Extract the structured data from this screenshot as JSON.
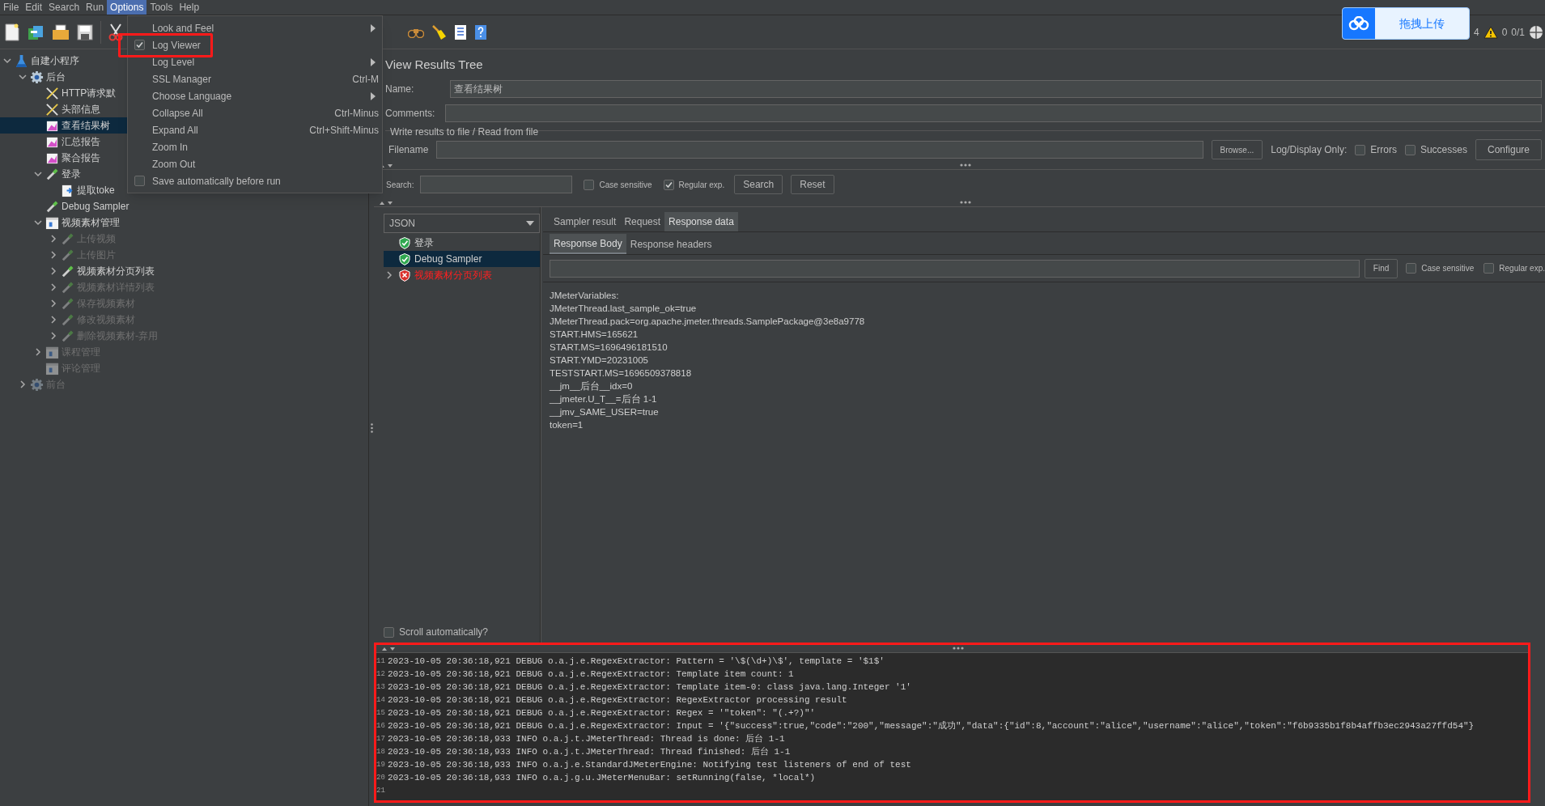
{
  "menu_bar": [
    {
      "label": "File",
      "selected": false
    },
    {
      "label": "Edit",
      "selected": false
    },
    {
      "label": "Search",
      "selected": false
    },
    {
      "label": "Run",
      "selected": false
    },
    {
      "label": "Options",
      "selected": true
    },
    {
      "label": "Tools",
      "selected": false
    },
    {
      "label": "Help",
      "selected": false
    }
  ],
  "options_menu": [
    {
      "kind": "submenu",
      "label": "Look and Feel",
      "highlighted": false
    },
    {
      "kind": "check",
      "label": "Log Viewer",
      "checked": true,
      "highlighted": true
    },
    {
      "kind": "submenu",
      "label": "Log Level",
      "highlighted": false
    },
    {
      "kind": "command",
      "label": "SSL Manager",
      "shortcut": "Ctrl-M",
      "highlighted": false
    },
    {
      "kind": "submenu",
      "label": "Choose Language",
      "highlighted": false
    },
    {
      "kind": "command",
      "label": "Collapse All",
      "shortcut": "Ctrl-Minus",
      "highlighted": false
    },
    {
      "kind": "command",
      "label": "Expand All",
      "shortcut": "Ctrl+Shift-Minus",
      "highlighted": false
    },
    {
      "kind": "command",
      "label": "Zoom In",
      "highlighted": false
    },
    {
      "kind": "command",
      "label": "Zoom Out",
      "highlighted": false
    },
    {
      "kind": "check",
      "label": "Save automatically before run",
      "checked": false,
      "highlighted": false
    }
  ],
  "upload_button": "拖拽上传",
  "status": {
    "errors_count": "4",
    "warnings_count": "0",
    "threads": "0/1"
  },
  "tree": [
    {
      "label": "自建小程序",
      "kind": "flask",
      "expanded": true,
      "selected": false,
      "disabled": false,
      "children": [
        {
          "label": "后台",
          "kind": "gear",
          "expanded": true,
          "selected": false,
          "disabled": false,
          "children": [
            {
              "label": "HTTP请求默",
              "kind": "tools",
              "selected": false,
              "disabled": false
            },
            {
              "label": "头部信息",
              "kind": "tools",
              "selected": false,
              "disabled": false
            },
            {
              "label": "查看结果树",
              "kind": "chart",
              "selected": true,
              "disabled": false
            },
            {
              "label": "汇总报告",
              "kind": "chart",
              "selected": false,
              "disabled": false
            },
            {
              "label": "聚合报告",
              "kind": "chart",
              "selected": false,
              "disabled": false
            },
            {
              "label": "登录",
              "kind": "pipette",
              "expanded": true,
              "selected": false,
              "disabled": false,
              "children": [
                {
                  "label": "提取toke",
                  "kind": "script",
                  "selected": false,
                  "disabled": false
                }
              ]
            },
            {
              "label": "Debug Sampler",
              "kind": "pipette",
              "selected": false,
              "disabled": false
            },
            {
              "label": "视频素材管理",
              "kind": "controller",
              "expanded": true,
              "selected": false,
              "disabled": false,
              "children": [
                {
                  "label": "上传视频",
                  "kind": "pipette",
                  "expanded": false,
                  "selected": false,
                  "disabled": true
                },
                {
                  "label": "上传图片",
                  "kind": "pipette",
                  "expanded": false,
                  "selected": false,
                  "disabled": true
                },
                {
                  "label": "视频素材分页列表",
                  "kind": "pipette",
                  "expanded": false,
                  "selected": false,
                  "disabled": false
                },
                {
                  "label": "视频素材详情列表",
                  "kind": "pipette",
                  "expanded": false,
                  "selected": false,
                  "disabled": true
                },
                {
                  "label": "保存视频素材",
                  "kind": "pipette",
                  "expanded": false,
                  "selected": false,
                  "disabled": true
                },
                {
                  "label": "修改视频素材",
                  "kind": "pipette",
                  "expanded": false,
                  "selected": false,
                  "disabled": true
                },
                {
                  "label": "删除视频素材-弃用",
                  "kind": "pipette",
                  "expanded": false,
                  "selected": false,
                  "disabled": true
                }
              ]
            },
            {
              "label": "课程管理",
              "kind": "controller",
              "expanded": false,
              "selected": false,
              "disabled": true
            },
            {
              "label": "评论管理",
              "kind": "controller",
              "selected": false,
              "disabled": true
            }
          ]
        },
        {
          "label": "前台",
          "kind": "gear",
          "expanded": false,
          "selected": false,
          "disabled": true
        }
      ]
    }
  ],
  "panel": {
    "title": "View Results Tree",
    "name_label": "Name:",
    "name_value": "查看结果树",
    "comments_label": "Comments:",
    "file_section_title": "Write results to file / Read from file",
    "filename_label": "Filename",
    "browse_button": "Browse...",
    "log_display_label": "Log/Display Only:",
    "errors": {
      "label": "Errors",
      "checked": false
    },
    "successes": {
      "label": "Successes",
      "checked": false
    },
    "configure_button": "Configure"
  },
  "search": {
    "label": "Search:",
    "case_sensitive": {
      "label": "Case sensitive",
      "checked": false
    },
    "regular_exp": {
      "label": "Regular exp.",
      "checked": true
    },
    "search_button": "Search",
    "reset_button": "Reset"
  },
  "renderer": "JSON",
  "results": [
    {
      "label": "登录",
      "kind": "success",
      "selected": false
    },
    {
      "label": "Debug Sampler",
      "kind": "success",
      "selected": true
    },
    {
      "label": "视频素材分页列表",
      "kind": "error",
      "selected": false,
      "expanded": false
    }
  ],
  "scroll_automatically": {
    "label": "Scroll automatically?",
    "checked": false
  },
  "tabs": [
    {
      "label": "Sampler result",
      "selected": false
    },
    {
      "label": "Request",
      "selected": false
    },
    {
      "label": "Response data",
      "selected": true
    }
  ],
  "subtabs": [
    {
      "label": "Response Body",
      "selected": true
    },
    {
      "label": "Response headers",
      "selected": false
    }
  ],
  "find": {
    "button": "Find",
    "case_sensitive": {
      "label": "Case sensitive",
      "checked": false
    },
    "regular_exp": {
      "label": "Regular exp.",
      "checked": false
    }
  },
  "response_lines": [
    "JMeterVariables:",
    "JMeterThread.last_sample_ok=true",
    "JMeterThread.pack=org.apache.jmeter.threads.SamplePackage@3e8a9778",
    "START.HMS=165621",
    "START.MS=1696496181510",
    "START.YMD=20231005",
    "TESTSTART.MS=1696509378818",
    "__jm__后台__idx=0",
    "__jmeter.U_T__=后台 1-1",
    "__jmv_SAME_USER=true",
    "token=1"
  ],
  "log": {
    "highlighted": true,
    "lines": [
      {
        "number": "11",
        "text": "2023-10-05 20:36:18,921 DEBUG o.a.j.e.RegexExtractor: Pattern = '\\$(\\d+)\\$', template = '$1$'"
      },
      {
        "number": "12",
        "text": "2023-10-05 20:36:18,921 DEBUG o.a.j.e.RegexExtractor: Template item count: 1"
      },
      {
        "number": "13",
        "text": "2023-10-05 20:36:18,921 DEBUG o.a.j.e.RegexExtractor: Template item-0: class java.lang.Integer '1'"
      },
      {
        "number": "14",
        "text": "2023-10-05 20:36:18,921 DEBUG o.a.j.e.RegexExtractor: RegexExtractor processing result"
      },
      {
        "number": "15",
        "text": "2023-10-05 20:36:18,921 DEBUG o.a.j.e.RegexExtractor: Regex = '\"token\": \"(.+?)\"'"
      },
      {
        "number": "16",
        "text": "2023-10-05 20:36:18,921 DEBUG o.a.j.e.RegexExtractor: Input = '{\"success\":true,\"code\":\"200\",\"message\":\"成功\",\"data\":{\"id\":8,\"account\":\"alice\",\"username\":\"alice\",\"token\":\"f6b9335b1f8b4affb3ec2943a27ffd54\"}"
      },
      {
        "number": "17",
        "text": "2023-10-05 20:36:18,933 INFO o.a.j.t.JMeterThread: Thread is done: 后台 1-1"
      },
      {
        "number": "18",
        "text": "2023-10-05 20:36:18,933 INFO o.a.j.t.JMeterThread: Thread finished: 后台 1-1"
      },
      {
        "number": "19",
        "text": "2023-10-05 20:36:18,933 INFO o.a.j.e.StandardJMeterEngine: Notifying test listeners of end of test"
      },
      {
        "number": "20",
        "text": "2023-10-05 20:36:18,933 INFO o.a.j.g.u.JMeterMenuBar: setRunning(false, *local*)"
      },
      {
        "number": "21"
      }
    ]
  }
}
